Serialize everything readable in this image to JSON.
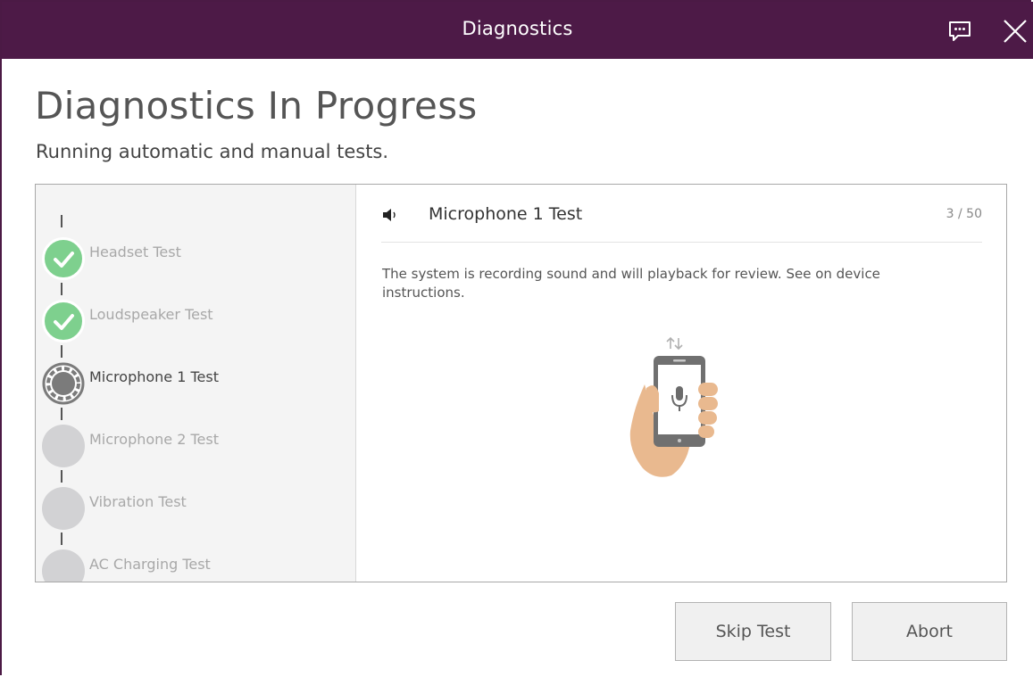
{
  "window": {
    "title": "Diagnostics",
    "accent_color": "#4d1a47",
    "icons": {
      "feedback": "feedback-icon",
      "close": "close-icon"
    }
  },
  "page": {
    "heading": "Diagnostics In Progress",
    "subheading": "Running automatic and manual tests."
  },
  "steps": [
    {
      "label": "Headset Test",
      "status": "done"
    },
    {
      "label": "Loudspeaker Test",
      "status": "done"
    },
    {
      "label": "Microphone 1 Test",
      "status": "active"
    },
    {
      "label": "Microphone 2 Test",
      "status": "pending"
    },
    {
      "label": "Vibration Test",
      "status": "pending"
    },
    {
      "label": "AC Charging Test",
      "status": "pending"
    }
  ],
  "current_test": {
    "icon": "speaker-icon",
    "name": "Microphone 1 Test",
    "counter": "3 / 50",
    "description": "The system is recording sound and will playback for review. See on device instructions.",
    "illustration": "hand-holding-phone-microphone-illustration"
  },
  "buttons": {
    "skip": "Skip Test",
    "abort": "Abort"
  },
  "colors": {
    "done": "#7ed08e",
    "pending": "#d2d2d4",
    "active_ring": "#7b7b7b"
  }
}
